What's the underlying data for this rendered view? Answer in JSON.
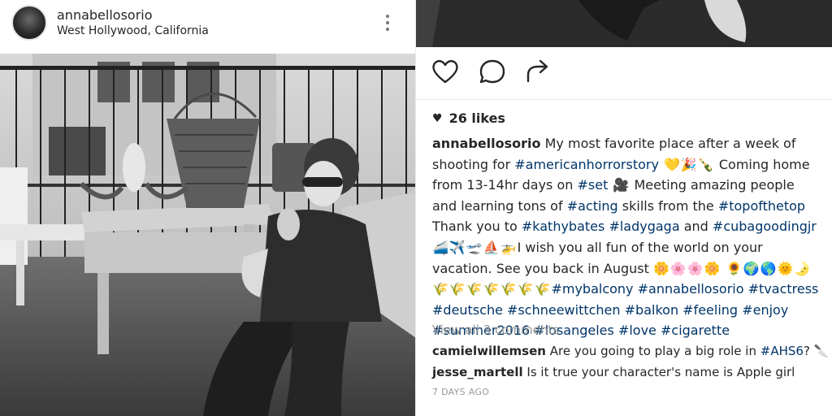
{
  "post": {
    "username": "annabellosorio",
    "location": "West Hollywood, California",
    "more_icon": "vertical-ellipsis-icon"
  },
  "actions": {
    "like_icon": "heart-outline-icon",
    "comment_icon": "speech-bubble-icon",
    "share_icon": "share-arrow-icon"
  },
  "likes": {
    "heart_glyph": "♥",
    "label": "26 likes"
  },
  "caption": {
    "username": "annabellosorio",
    "t1": " My most favorite place after a week of shooting for ",
    "h1": "#americanhorrorstory",
    "e1": " 💛🎉🍾",
    "t2": " Coming home from 13-14hr days on ",
    "h2": "#set",
    "e2": " 🎥",
    "t3": " Meeting amazing people and learning tons of ",
    "h3": "#acting",
    "t4": " skills from the ",
    "h4": "#topofthetop",
    "t5": " Thank you to ",
    "h5": "#kathybates",
    "h6": "#ladygaga",
    "t6": " and ",
    "h7": "#cubagoodingjr",
    "e3": " 🚄✈️🛫⛵🚁",
    "t7": "I wish you all fun of the world on your vacation. See you back in August ",
    "e4": "🌼🌸🌸🌼 🌻🌍🌎🌞🌛🌾🌾🌾🌾🌾🌾🌾",
    "h8": "#mybalcony",
    "h9": "#annabellosorio",
    "h10": "#tvactress",
    "h11": "#deutsche",
    "h12": "#schneewittchen",
    "h13": "#balkon",
    "h14": "#feeling",
    "h15": "#enjoy",
    "h16": "#summer2016",
    "h17": "#losangeles",
    "h18": "#love",
    "h19": "#cigarette"
  },
  "comments": {
    "view_all": "View all 3 comments",
    "items": [
      {
        "username": "camielwillemsen",
        "t1": " Are you going to play a big role in ",
        "tag": "#AHS6",
        "t2": "? 🔪"
      },
      {
        "username": "jesse_martell",
        "t1": " Is it true your character's name is Apple girl"
      }
    ]
  },
  "timestamp": "7 DAYS AGO",
  "colors": {
    "text": "#262626",
    "hashtag": "#003569",
    "muted": "#999999"
  }
}
